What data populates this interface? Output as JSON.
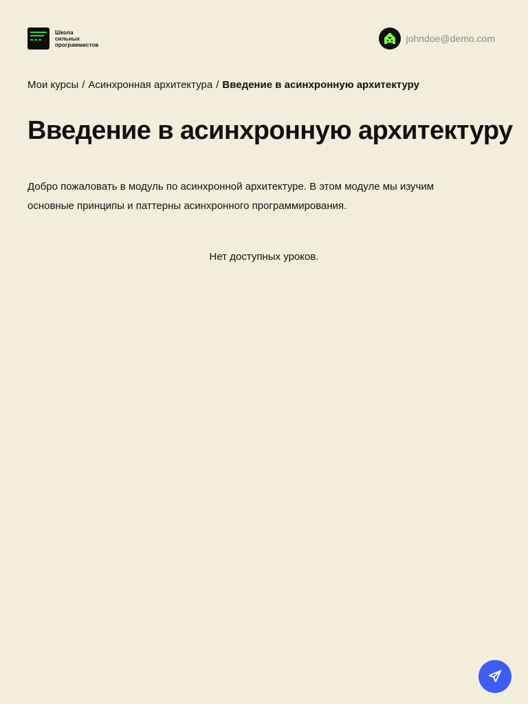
{
  "header": {
    "logo": {
      "line1": "Школа",
      "line2": "сильных",
      "line3": "программистов"
    },
    "user": {
      "email": "johndoe@demo.com"
    }
  },
  "breadcrumb": {
    "items": [
      "Мои курсы",
      "Асинхронная архитектура"
    ],
    "separator": "/",
    "current": "Введение в асинхронную архитектуру"
  },
  "page": {
    "title": "Введение в асинхронную архитектуру",
    "description": "Добро пожаловать в модуль по асинхронной архитектуре. В этом модуле мы изучим основные принципы и паттерны асинхронного программирования.",
    "empty_message": "Нет доступных уроков."
  },
  "icons": {
    "logo": "terminal-lines-icon",
    "avatar": "pixel-creature-icon",
    "fab": "paper-plane-icon"
  },
  "colors": {
    "background": "#f2eedb",
    "logo_accent": "#2fd35a",
    "avatar_accent": "#7cff3a",
    "fab": "#3f5cf5"
  }
}
